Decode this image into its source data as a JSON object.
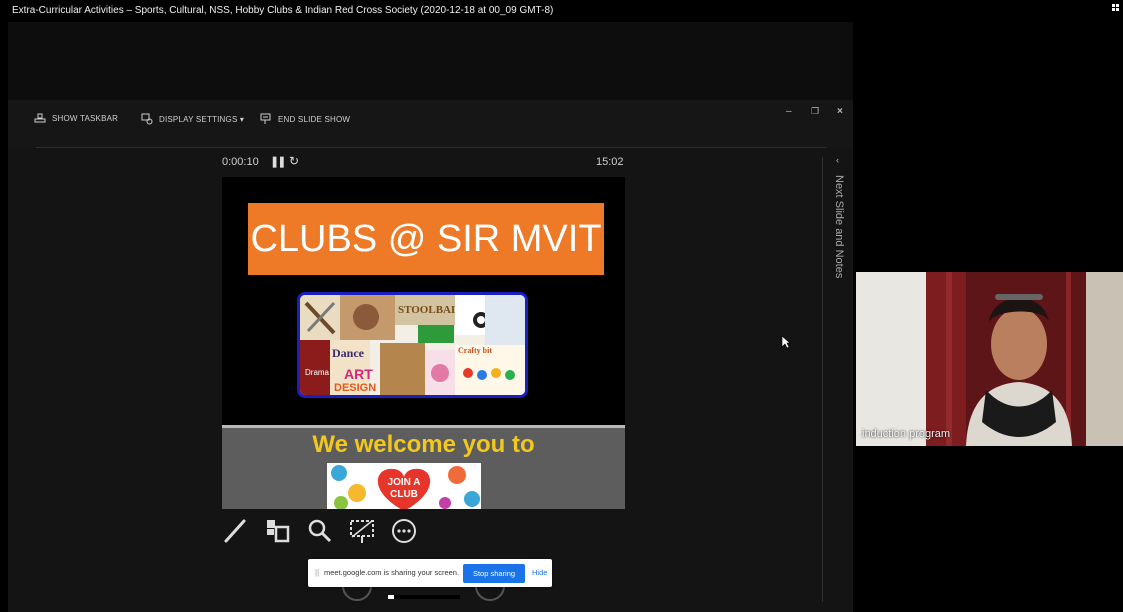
{
  "window": {
    "title": "Extra-Curricular Activities – Sports, Cultural, NSS, Hobby Clubs & Indian Red Cross Society  (2020-12-18 at 00_09 GMT-8)"
  },
  "toolbar": {
    "show_taskbar": "SHOW TASKBAR",
    "display_settings": "DISPLAY SETTINGS ▾",
    "end_slide_show": "END SLIDE SHOW",
    "minimize": "–",
    "restore": "❐",
    "close": "×"
  },
  "presenter": {
    "elapsed": "0:00:10",
    "clock": "15:02",
    "pause_icon": "pause-icon",
    "restart_icon": "restart-icon"
  },
  "current_slide": {
    "title": "CLUBS @ SIR MVIT",
    "collage_words": [
      "STOOLBALL",
      "Dance",
      "ART",
      "DESIGN",
      "Drama",
      "Crafty bit"
    ],
    "title_color": "#ee7a28",
    "border_color": "#1a1fbf"
  },
  "next_slide": {
    "headline": "We welcome you to",
    "badge_line1": "JOIN A",
    "badge_line2": "CLUB",
    "text_color": "#f2c81e"
  },
  "tools": [
    "pen-icon",
    "slides-grid-icon",
    "zoom-icon",
    "black-screen-icon",
    "more-options-icon"
  ],
  "side_panel": {
    "label": "Next Slide and Notes",
    "arrow": "‹"
  },
  "share_bar": {
    "grip": "||",
    "message": "meet.google.com is sharing your screen.",
    "stop_label": "Stop sharing",
    "hide_label": "Hide",
    "accent": "#1a73e8"
  },
  "video_tile": {
    "participant_name": "induction program"
  },
  "progress": {
    "fraction": 0.08
  }
}
